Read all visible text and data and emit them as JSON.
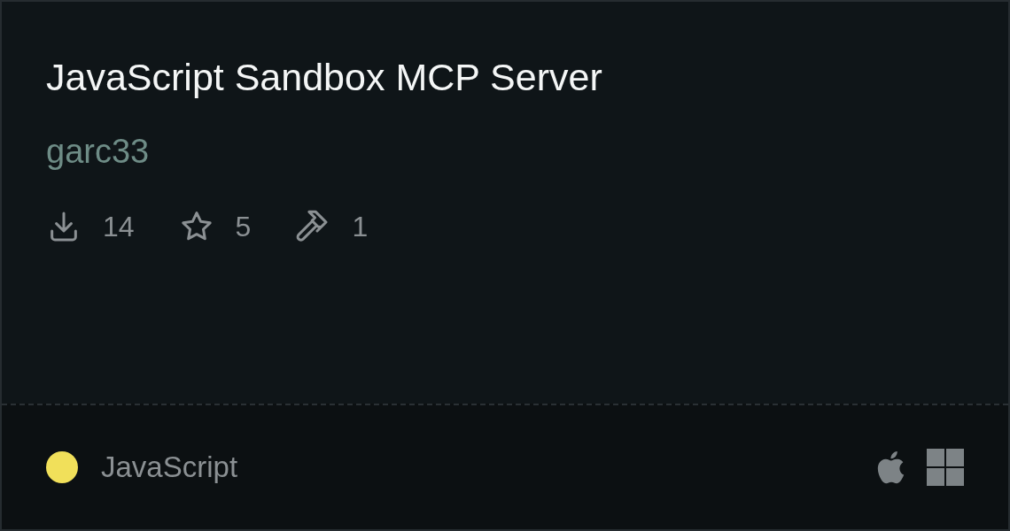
{
  "title": "JavaScript Sandbox MCP Server",
  "author": "garc33",
  "stats": [
    {
      "kind": "downloads",
      "value": "14"
    },
    {
      "kind": "stars",
      "value": "5"
    },
    {
      "kind": "tools",
      "value": "1"
    }
  ],
  "language": {
    "name": "JavaScript",
    "color": "#f1e05a"
  },
  "platforms": [
    {
      "kind": "apple"
    },
    {
      "kind": "windows"
    }
  ]
}
